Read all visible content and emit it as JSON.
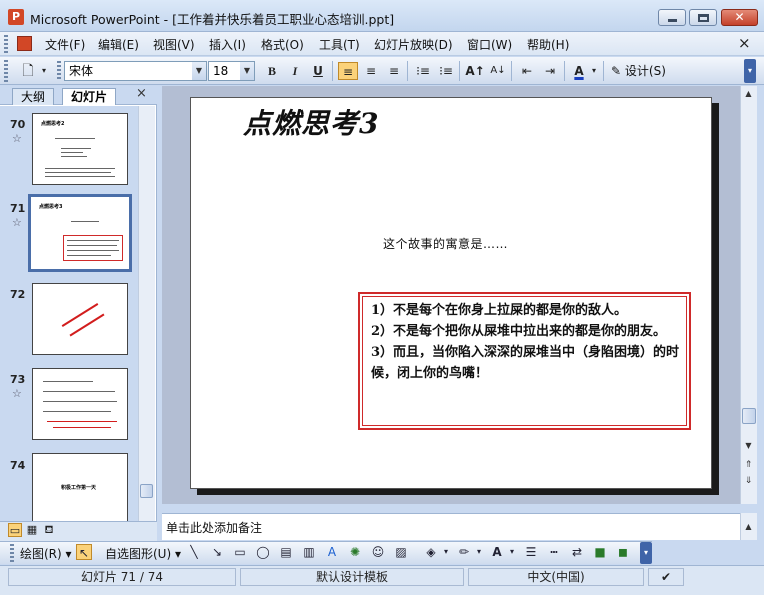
{
  "window": {
    "title": "Microsoft PowerPoint - [工作着并快乐着员工职业心态培训.ppt]",
    "app_icon": "P"
  },
  "menu": {
    "items": [
      "文件(F)",
      "编辑(E)",
      "视图(V)",
      "插入(I)",
      "格式(O)",
      "工具(T)",
      "幻灯片放映(D)",
      "窗口(W)",
      "帮助(H)"
    ],
    "close": "×"
  },
  "toolbar": {
    "font_name": "宋体",
    "font_size": "18",
    "bold": "B",
    "italic": "I",
    "underline": "U",
    "design_label": "设计(S)",
    "active_align": "align-left"
  },
  "left_panel": {
    "tabs": [
      "大纲",
      "幻灯片"
    ],
    "active_tab": "幻灯片",
    "close": "×",
    "slides": [
      {
        "number": "70",
        "star": "☆",
        "title": "点燃思考2"
      },
      {
        "number": "71",
        "star": "☆",
        "title": "点燃思考3",
        "selected": true
      },
      {
        "number": "72",
        "star": ""
      },
      {
        "number": "73",
        "star": "☆"
      },
      {
        "number": "74",
        "star": "",
        "title": "积极工作第一天"
      }
    ]
  },
  "slide": {
    "title": "点燃思考3",
    "subtitle": "这个故事的寓意是……",
    "points": [
      "1）不是每个在你身上拉屎的都是你的敌人。",
      "2）不是每个把你从屎堆中拉出来的都是你的朋友。",
      "3）而且，当你陷入深深的屎堆当中（身陷困境）的时候，闭上你的鸟嘴！"
    ]
  },
  "notes": {
    "placeholder": "单击此处添加备注"
  },
  "drawing_toolbar": {
    "draw_label": "绘图(R)",
    "autoshape_label": "自选图形(U)"
  },
  "status": {
    "slide_position": "幻灯片 71 / 74",
    "template": "默认设计模板",
    "language": "中文(中国)"
  },
  "colors": {
    "accent_red": "#cf2a2a",
    "office_blue": "#3f64a8",
    "highlight": "#fbd27a"
  }
}
